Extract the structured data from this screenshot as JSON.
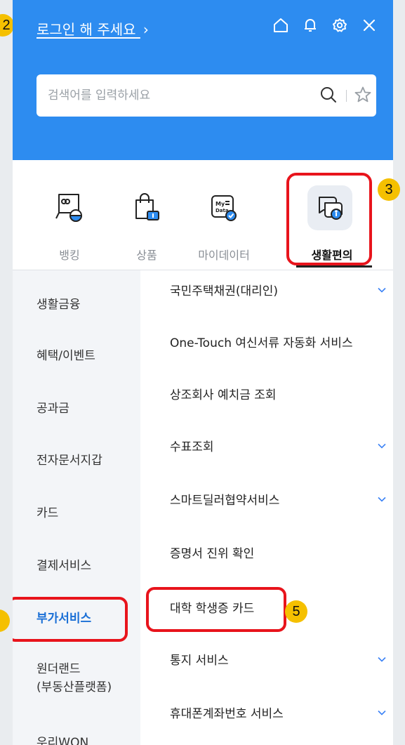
{
  "header": {
    "login_text": "로그인 해 주세요",
    "login_chevron": "›",
    "icons": [
      "home-icon",
      "bell-icon",
      "gear-icon",
      "close-icon"
    ],
    "bg_color": "#2d8cf0"
  },
  "search": {
    "placeholder": "검색어를 입력하세요",
    "value": ""
  },
  "categories": [
    {
      "label": "뱅킹",
      "icon": "banking-icon",
      "active": false
    },
    {
      "label": "상품",
      "icon": "shopping-bag-icon",
      "active": false
    },
    {
      "label": "마이데이터",
      "icon": "mydata-icon",
      "active": true,
      "icon_text": "My Data"
    },
    {
      "label": "생활편의",
      "icon": "chat-bubbles-icon",
      "active": true
    }
  ],
  "left_menu": [
    {
      "label": "생활금융",
      "active": false
    },
    {
      "label": "혜택/이벤트",
      "active": false
    },
    {
      "label": "공과금",
      "active": false
    },
    {
      "label": "전자문서지갑",
      "active": false
    },
    {
      "label": "카드",
      "active": false
    },
    {
      "label": "결제서비스",
      "active": false
    },
    {
      "label": "부가서비스",
      "active": true
    },
    {
      "label": "원더랜드",
      "active": false,
      "line2": "(부동산플랫폼)"
    },
    {
      "label": "우리WON",
      "active": false
    }
  ],
  "right_list": [
    {
      "label": "국민주택채권(대리인)",
      "expandable": true
    },
    {
      "label": "One-Touch 여신서류 자동화 서비스",
      "expandable": false
    },
    {
      "label": "상조회사 예치금 조회",
      "expandable": false
    },
    {
      "label": "수표조회",
      "expandable": true
    },
    {
      "label": "스마트딜러협약서비스",
      "expandable": true
    },
    {
      "label": "증명서 진위 확인",
      "expandable": false
    },
    {
      "label": "대학 학생증 카드",
      "expandable": false
    },
    {
      "label": "통지 서비스",
      "expandable": true
    },
    {
      "label": "휴대폰계좌번호 서비스",
      "expandable": true
    }
  ],
  "annotations": {
    "badge_2": "2",
    "badge_3": "3",
    "badge_5": "5",
    "highlight_color": "#e8141c",
    "badge_color": "#f5c000"
  }
}
